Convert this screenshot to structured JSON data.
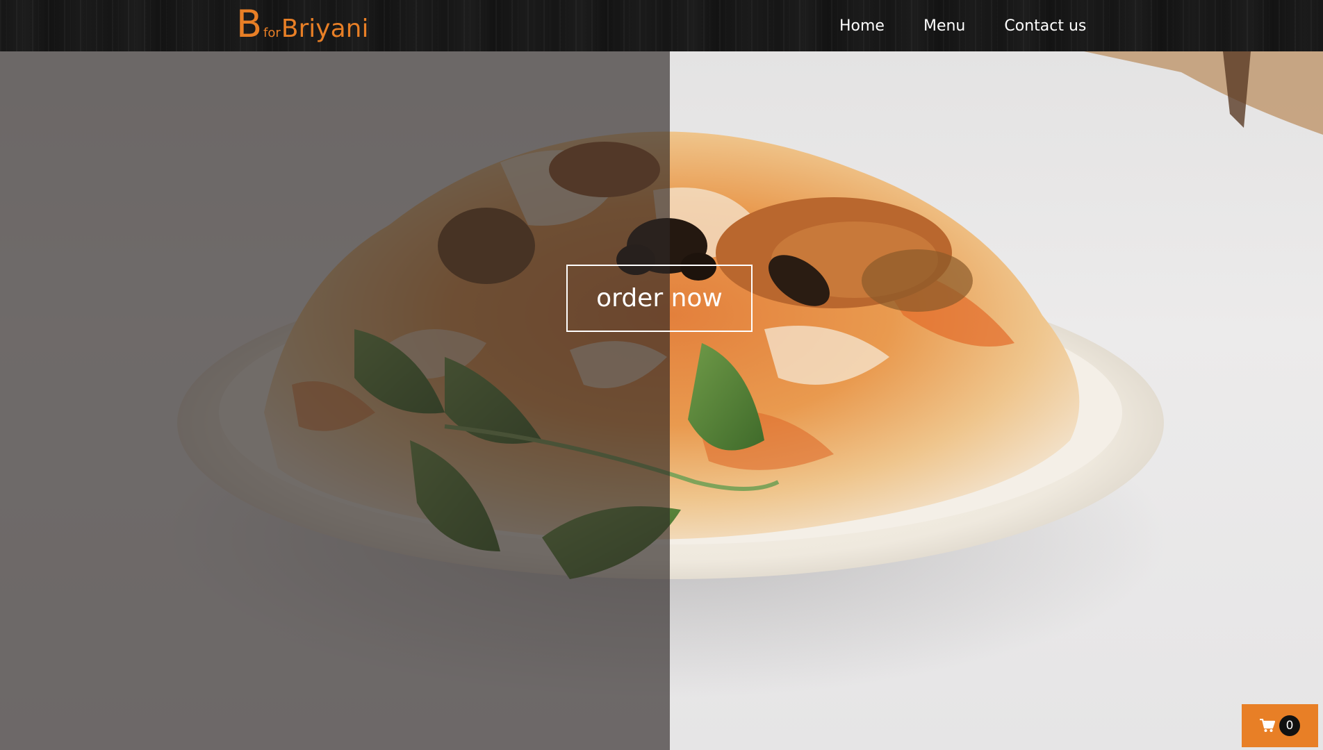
{
  "brand": {
    "initial": "B",
    "connector": "for",
    "name": "Briyani",
    "color": "#e87f26"
  },
  "nav": {
    "items": [
      {
        "label": "Home"
      },
      {
        "label": "Menu"
      },
      {
        "label": "Contact us"
      }
    ]
  },
  "hero": {
    "cta_label": "order now",
    "image_subject": "biryani-plate-with-mint"
  },
  "cart": {
    "icon": "shopping-cart-icon",
    "count": "0",
    "color": "#e87f26"
  }
}
